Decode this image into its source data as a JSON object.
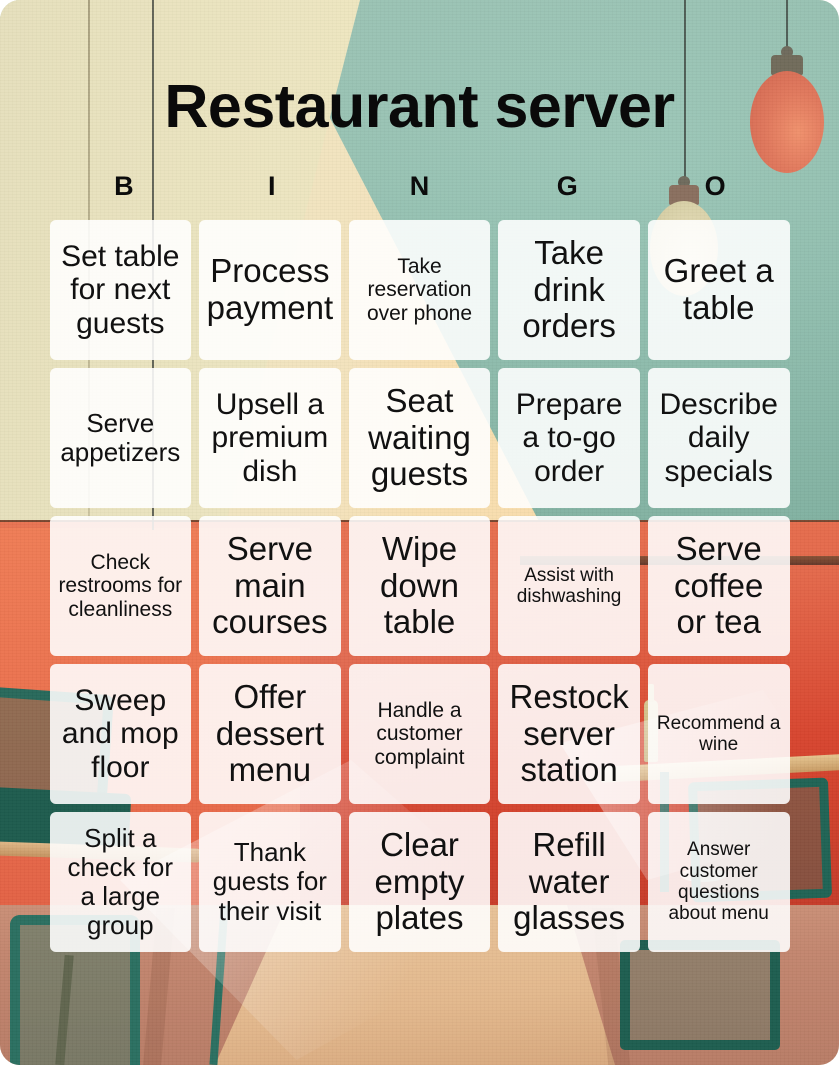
{
  "card": {
    "title": "Restaurant server",
    "bingo_letters": [
      "B",
      "I",
      "N",
      "G",
      "O"
    ],
    "accent_colors": {
      "wall_cream": "#ece5c0",
      "wall_teal": "#8fbfae",
      "wall_red": "#d8452f",
      "floor": "#c2866e",
      "chair_green": "#1f6354",
      "lamp_orange": "#e1785c",
      "lamp_cream": "#ded6ae",
      "cell_background": "#ffffff",
      "text": "#111111"
    }
  },
  "grid": {
    "columns": 5,
    "rows": 5,
    "cells": [
      {
        "text": "Set table for next guests",
        "size": "lg"
      },
      {
        "text": "Process payment",
        "size": "xl"
      },
      {
        "text": "Take reservation over phone",
        "size": "sm"
      },
      {
        "text": "Take drink orders",
        "size": "xl"
      },
      {
        "text": "Greet a table",
        "size": "xl"
      },
      {
        "text": "Serve appetizers",
        "size": "md"
      },
      {
        "text": "Upsell a premium dish",
        "size": "lg"
      },
      {
        "text": "Seat waiting guests",
        "size": "xl"
      },
      {
        "text": "Prepare a to-go order",
        "size": "lg"
      },
      {
        "text": "Describe daily specials",
        "size": "lg"
      },
      {
        "text": "Check restrooms for cleanliness",
        "size": "sm"
      },
      {
        "text": "Serve main courses",
        "size": "xl"
      },
      {
        "text": "Wipe down table",
        "size": "xl"
      },
      {
        "text": "Assist with dishwashing",
        "size": "xs"
      },
      {
        "text": "Serve coffee or tea",
        "size": "xl"
      },
      {
        "text": "Sweep and mop floor",
        "size": "lg"
      },
      {
        "text": "Offer dessert menu",
        "size": "xl"
      },
      {
        "text": "Handle a customer complaint",
        "size": "sm"
      },
      {
        "text": "Restock server station",
        "size": "xl"
      },
      {
        "text": "Recommend a wine",
        "size": "xs"
      },
      {
        "text": "Split a check for a large group",
        "size": "md"
      },
      {
        "text": "Thank guests for their visit",
        "size": "md"
      },
      {
        "text": "Clear empty plates",
        "size": "xl"
      },
      {
        "text": "Refill water glasses",
        "size": "xl"
      },
      {
        "text": "Answer customer questions about menu",
        "size": "xs"
      }
    ]
  }
}
